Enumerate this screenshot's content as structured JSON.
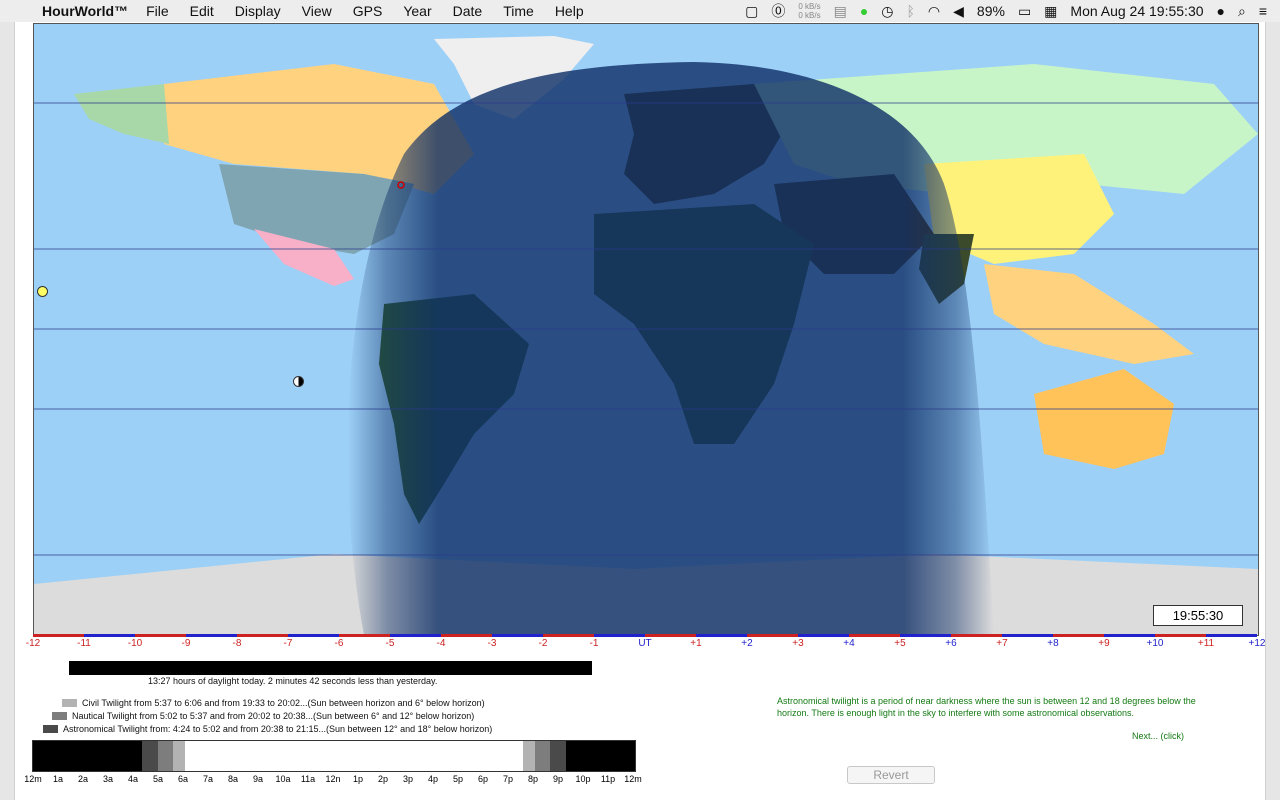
{
  "menubar": {
    "apple_glyph": "",
    "app_name": "HourWorld™",
    "menus": [
      "File",
      "Edit",
      "Display",
      "View",
      "GPS",
      "Year",
      "Date",
      "Time",
      "Help"
    ],
    "net_up": "0 kB/s",
    "net_down": "0 kB/s",
    "battery": "89%",
    "datetime": "Mon Aug 24  19:55:30"
  },
  "map": {
    "clock": "19:55:30"
  },
  "timezones": [
    "-12",
    "-11",
    "-10",
    "-9",
    "-8",
    "-7",
    "-6",
    "-5",
    "-4",
    "-3",
    "-2",
    "-1",
    "UT",
    "+1",
    "+2",
    "+3",
    "+4",
    "+5",
    "+6",
    "+7",
    "+8",
    "+9",
    "+10",
    "+11",
    "+12"
  ],
  "daylight_text": "13:27 hours of daylight today.  2 minutes 42 seconds  less than yesterday.",
  "legend": {
    "civil": "Civil Twilight from 5:37 to 6:06 and from 19:33 to 20:02...(Sun between horizon and 6° below horizon)",
    "nautical": "Nautical Twilight from 5:02 to 5:37 and from 20:02 to 20:38...(Sun between 6° and 12° below horizon)",
    "astronomical": "Astronomical Twilight from: 4:24 to 5:02 and from 20:38 to 21:15...(Sun between 12° and 18° below horizon)"
  },
  "hours": [
    "12m",
    "1a",
    "2a",
    "3a",
    "4a",
    "5a",
    "6a",
    "7a",
    "8a",
    "9a",
    "10a",
    "11a",
    "12n",
    "1p",
    "2p",
    "3p",
    "4p",
    "5p",
    "6p",
    "7p",
    "8p",
    "9p",
    "10p",
    "11p",
    "12m"
  ],
  "info_text": "Astronomical twilight is a period of near darkness where the sun is between 12 and 18 degrees below the horizon. There is enough light in the sky to interfere with some astronomical observations.",
  "next_link": "Next... (click)",
  "revert_label": "Revert",
  "colors": {
    "ocean_day": "#9dd0f7",
    "ocean_night": "#0d2e66",
    "info_green": "#137a13"
  }
}
